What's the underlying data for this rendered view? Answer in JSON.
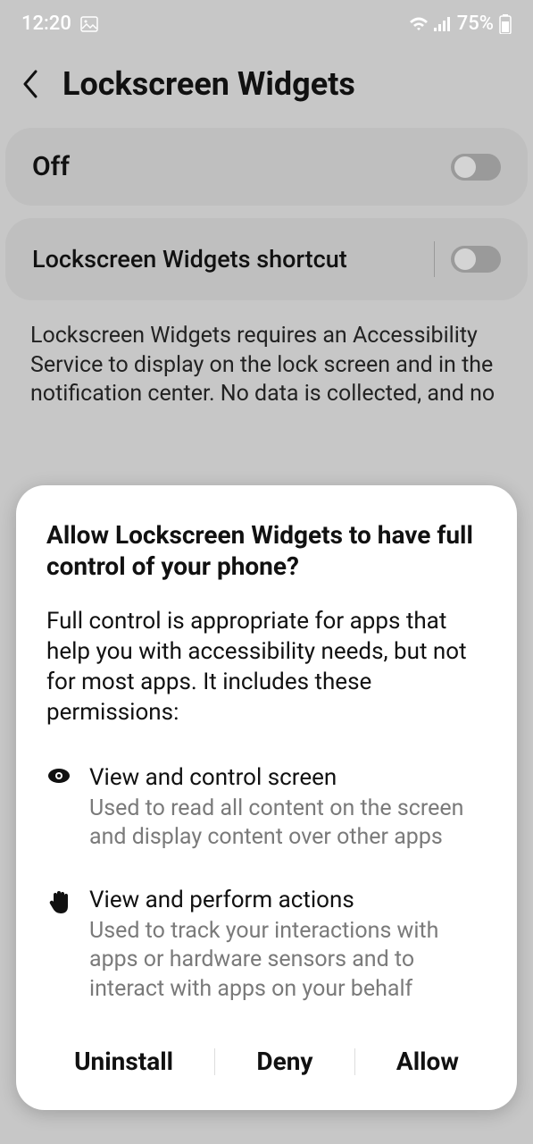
{
  "statusbar": {
    "time": "12:20",
    "battery": "75%"
  },
  "header": {
    "title": "Lockscreen Widgets"
  },
  "cards": {
    "main_toggle_label": "Off",
    "shortcut_label": "Lockscreen Widgets shortcut"
  },
  "description": "Lockscreen Widgets requires an Accessibility Service to display on the lock screen and in the notification center. No data is collected, and no",
  "dialog": {
    "title": "Allow Lockscreen Widgets to have full control of your phone?",
    "description": "Full control is appropriate for apps that help you with accessibility needs, but not for most apps. It includes these permissions:",
    "permissions": [
      {
        "title": "View and control screen",
        "desc": "Used to read all content on the screen and display content over other apps"
      },
      {
        "title": "View and perform actions",
        "desc": "Used to track your interactions with apps or hardware sensors and to interact with apps on your behalf"
      }
    ],
    "buttons": {
      "uninstall": "Uninstall",
      "deny": "Deny",
      "allow": "Allow"
    }
  }
}
